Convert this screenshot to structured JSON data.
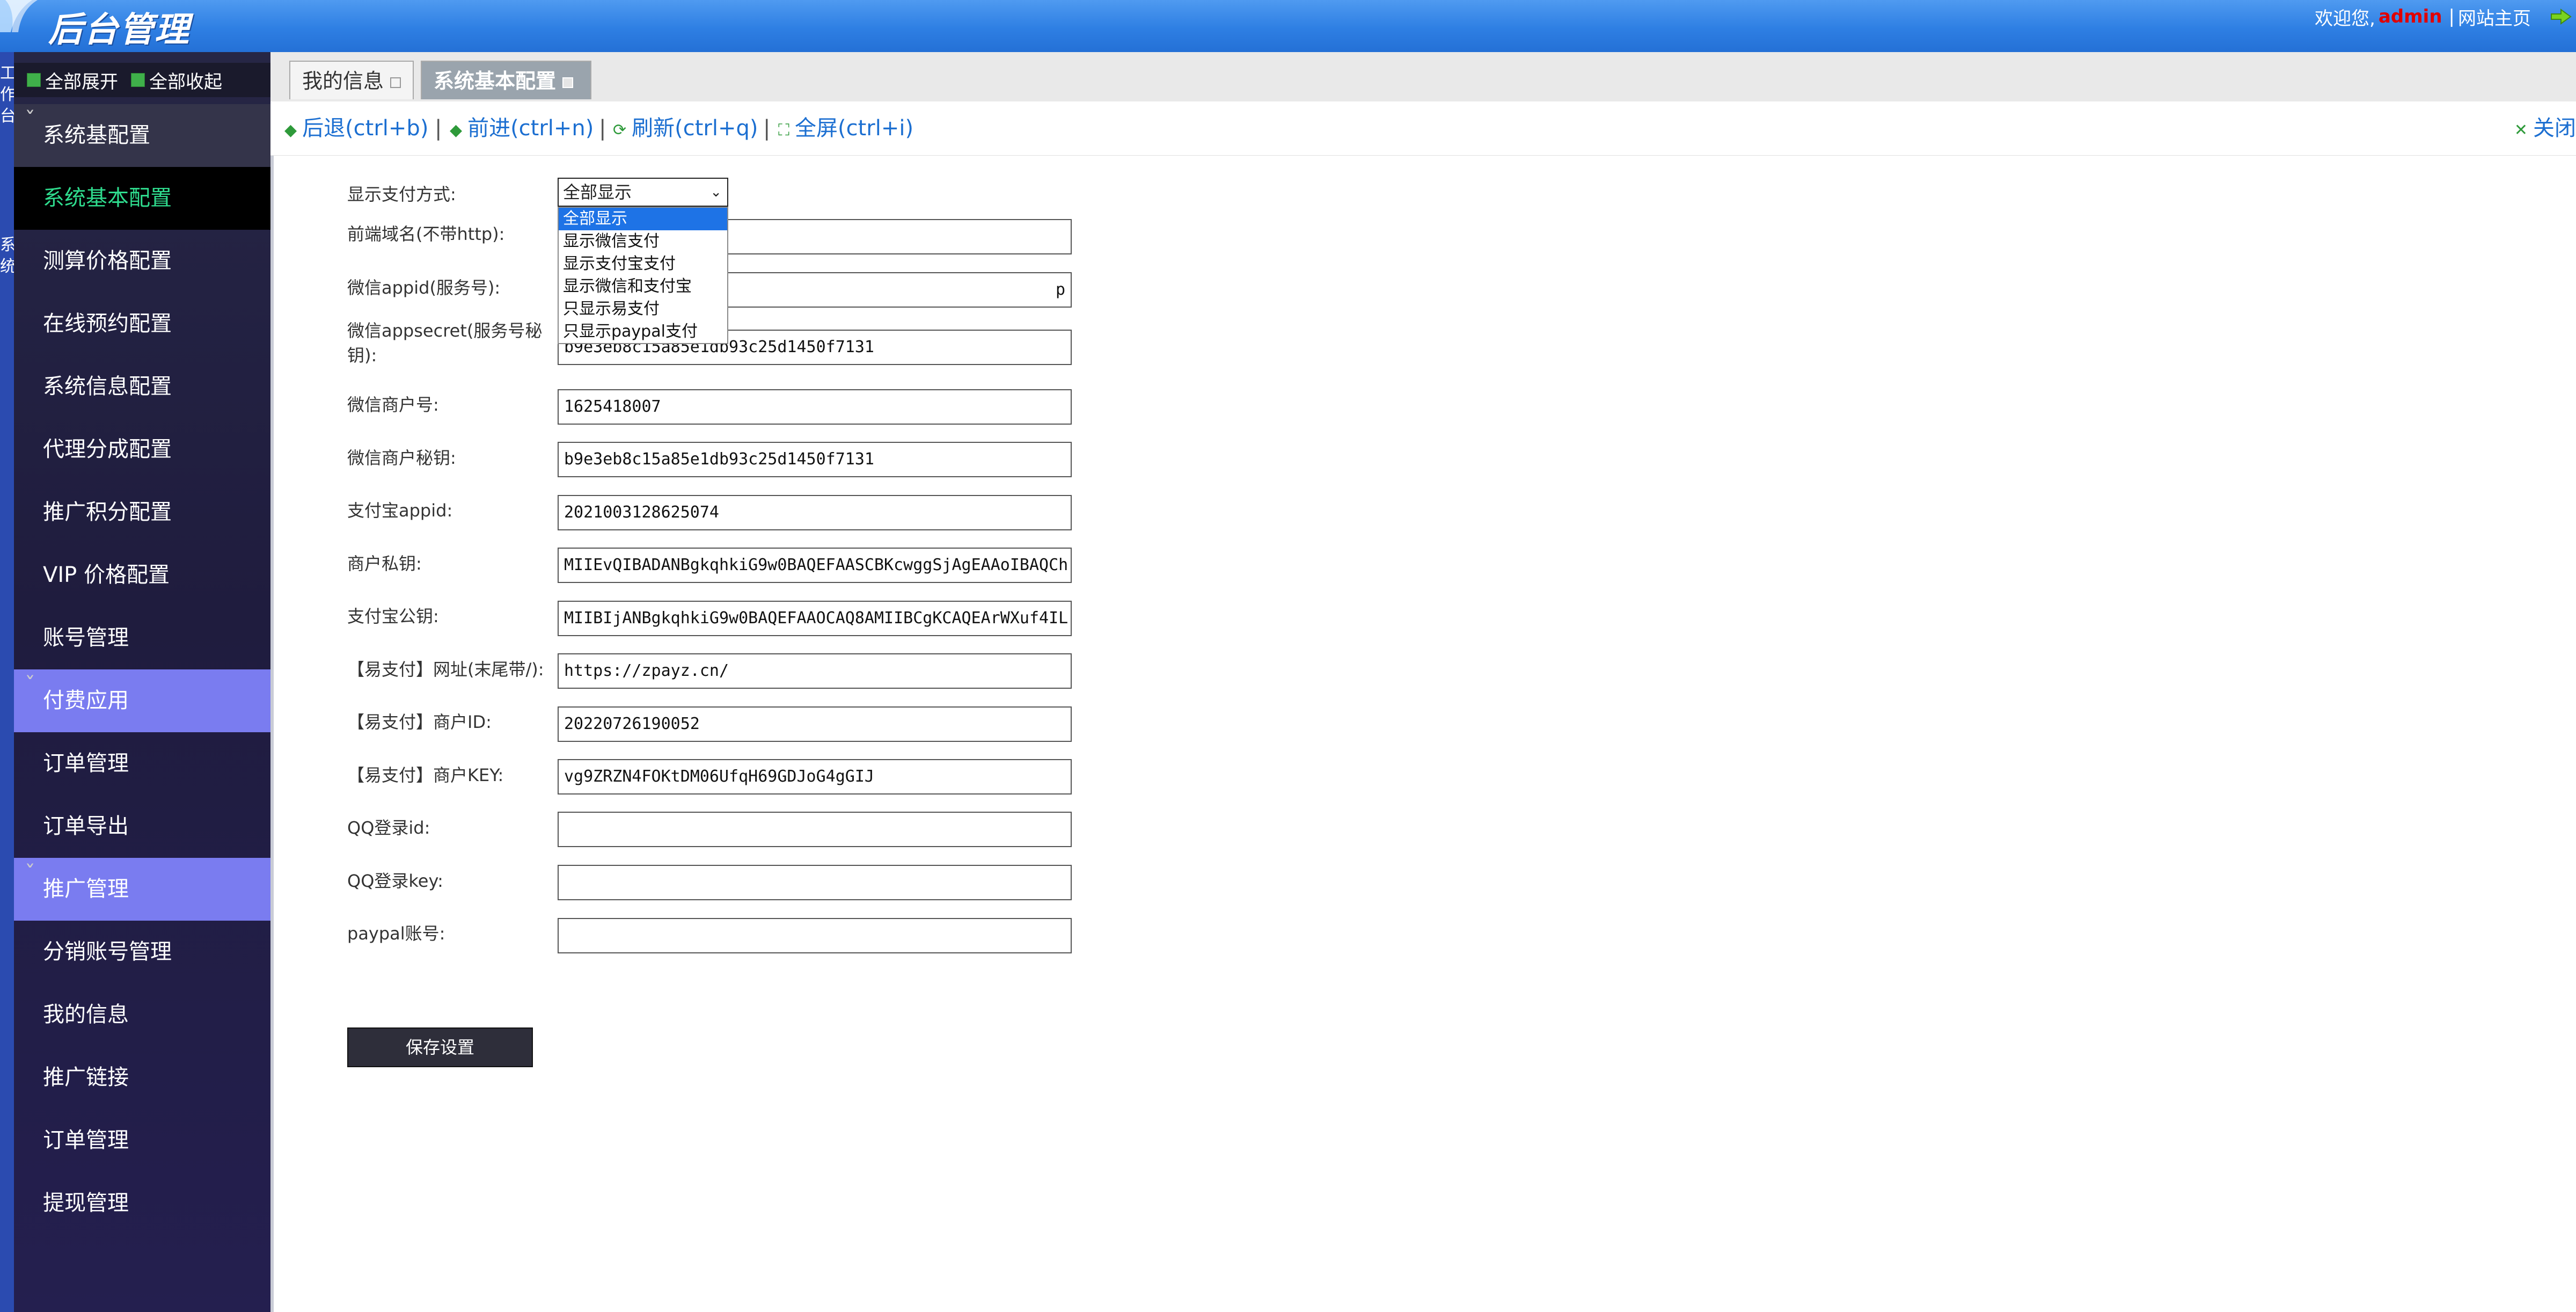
{
  "header": {
    "title": "后台管理",
    "welcome": "欢迎您,",
    "username": "admin",
    "site_home": "网站主页",
    "logout_icon": "logout-arrow-icon"
  },
  "rail": {
    "text_top": "工作台",
    "text_bottom": "系统"
  },
  "sidebar": {
    "expand_all": "全部展开",
    "collapse_all": "全部收起",
    "items": [
      {
        "label": "系统基配置",
        "kind": "group"
      },
      {
        "label": "系统基本配置",
        "kind": "active"
      },
      {
        "label": "测算价格配置",
        "kind": "item"
      },
      {
        "label": "在线预约配置",
        "kind": "item"
      },
      {
        "label": "系统信息配置",
        "kind": "item"
      },
      {
        "label": "代理分成配置",
        "kind": "item"
      },
      {
        "label": "推广积分配置",
        "kind": "item"
      },
      {
        "label": "VIP 价格配置",
        "kind": "item"
      },
      {
        "label": "账号管理",
        "kind": "item"
      },
      {
        "label": "付费应用",
        "kind": "group-purple"
      },
      {
        "label": "订单管理",
        "kind": "item"
      },
      {
        "label": "订单导出",
        "kind": "item"
      },
      {
        "label": "推广管理",
        "kind": "group-purple"
      },
      {
        "label": "分销账号管理",
        "kind": "item"
      },
      {
        "label": "我的信息",
        "kind": "item"
      },
      {
        "label": "推广链接",
        "kind": "item"
      },
      {
        "label": "订单管理",
        "kind": "item"
      },
      {
        "label": "提现管理",
        "kind": "item"
      }
    ]
  },
  "tabs": [
    {
      "label": "我的信息"
    },
    {
      "label": "系统基本配置"
    }
  ],
  "toolbar": {
    "back": "后退(ctrl+b)",
    "forward": "前进(ctrl+n)",
    "refresh": "刷新(ctrl+q)",
    "fullscreen": "全屏(ctrl+i)",
    "close_all": "关闭"
  },
  "form": {
    "pay_display_label": "显示支付方式:",
    "pay_display_selected": "全部显示",
    "pay_display_options": [
      "全部显示",
      "显示微信支付",
      "显示支付宝支付",
      "显示微信和支付宝",
      "只显示易支付",
      "只显示paypal支付"
    ],
    "fields": [
      {
        "label": "前端域名(不带http):",
        "value": ""
      },
      {
        "label": "微信appid(服务号):",
        "value": "p"
      },
      {
        "label": "微信appsecret(服务号秘钥):",
        "value": "b9e3eb8c15a85e1db93c25d1450f7131"
      },
      {
        "label": "微信商户号:",
        "value": "1625418007"
      },
      {
        "label": "微信商户秘钥:",
        "value": "b9e3eb8c15a85e1db93c25d1450f7131"
      },
      {
        "label": "支付宝appid:",
        "value": "2021003128625074"
      },
      {
        "label": "商户私钥:",
        "value": "MIIEvQIBADANBgkqhkiG9w0BAQEFAASCBKcwggSjAgEAAoIBAQCh"
      },
      {
        "label": "支付宝公钥:",
        "value": "MIIBIjANBgkqhkiG9w0BAQEFAAOCAQ8AMIIBCgKCAQEArWXuf4IL"
      },
      {
        "label": "【易支付】网址(末尾带/):",
        "value": "https://zpayz.cn/"
      },
      {
        "label": "【易支付】商户ID:",
        "value": "20220726190052"
      },
      {
        "label": "【易支付】商户KEY:",
        "value": "vg9ZRZN4FOKtDM06UfqH69GDJoG4gGIJ"
      },
      {
        "label": "QQ登录id:",
        "value": ""
      },
      {
        "label": "QQ登录key:",
        "value": ""
      },
      {
        "label": "paypal账号:",
        "value": ""
      }
    ],
    "save_label": "保存设置"
  }
}
